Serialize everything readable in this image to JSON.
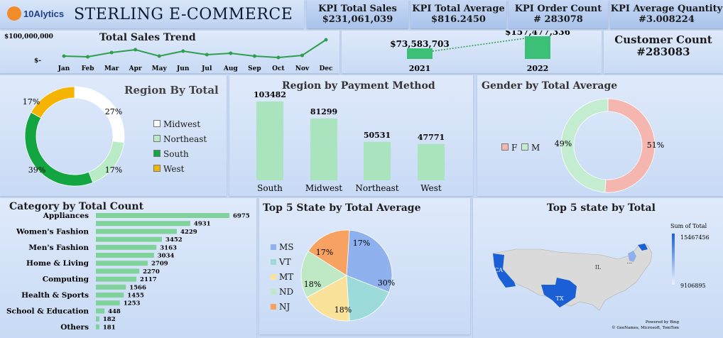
{
  "header": {
    "logo_text": "10Alytics",
    "title": "STERLING E-COMMERCE"
  },
  "kpis": [
    {
      "label": "KPI Total Sales",
      "value": "$231,061,039"
    },
    {
      "label": "KPI Total Average",
      "value": "$816.2450"
    },
    {
      "label": "KPI Order Count",
      "value": "# 283078"
    },
    {
      "label": "KPI Average Quantity",
      "value": "#3.008224"
    }
  ],
  "customer_count": {
    "label": "Customer Count",
    "value": "#283083"
  },
  "chart_data": [
    {
      "id": "sales-trend",
      "type": "line",
      "title": "Total Sales Trend",
      "categories": [
        "Jan",
        "Feb",
        "Mar",
        "Apr",
        "May",
        "Jun",
        "Jul",
        "Aug",
        "Sep",
        "Oct",
        "Nov",
        "Dec"
      ],
      "values": [
        1.0,
        0.5,
        3.5,
        5.5,
        1.0,
        4.5,
        2.0,
        3.0,
        1.0,
        0.0,
        1.5,
        12.5
      ],
      "ytick_labels": [
        "$100,000,000",
        "$-"
      ],
      "color": "#2e9e4f"
    },
    {
      "id": "yearly-sales",
      "type": "bar",
      "categories": [
        "2021",
        "2022"
      ],
      "values": [
        73583703,
        157477336
      ],
      "data_labels": [
        "$73,583,703",
        "$157,477,336"
      ],
      "color": "#3cbf76"
    },
    {
      "id": "region-total",
      "type": "pie",
      "title": "Region By Total",
      "labels": [
        "Midwest",
        "Northeast",
        "South",
        "West"
      ],
      "values": [
        27,
        17,
        39,
        17
      ],
      "data_labels": [
        "27%",
        "17%",
        "39%",
        "17%"
      ],
      "colors": [
        "#ffffff",
        "#b9ecc6",
        "#14a543",
        "#f4b400"
      ],
      "legend_position": "right"
    },
    {
      "id": "region-payment",
      "type": "bar",
      "title": "Region by Payment Method",
      "categories": [
        "South",
        "Midwest",
        "Northeast",
        "West"
      ],
      "values": [
        103482,
        81299,
        50531,
        47771
      ],
      "color": "#a9e4bf"
    },
    {
      "id": "gender-average",
      "type": "pie",
      "title": "Gender by Total Average",
      "labels": [
        "F",
        "M"
      ],
      "values": [
        51,
        49
      ],
      "data_labels": [
        "51%",
        "49%"
      ],
      "colors": [
        "#f6b6b0",
        "#c3ecd0"
      ],
      "legend_position": "left"
    },
    {
      "id": "category-count",
      "type": "bar",
      "orientation": "horizontal",
      "title": "Category by Total Count",
      "categories": [
        "Appliances",
        "",
        "Women's Fashion",
        "",
        "Men's Fashion",
        "",
        "Home & Living",
        "",
        "Computing",
        "",
        "Health & Sports",
        "",
        "School & Education",
        "",
        "Others"
      ],
      "values": [
        6975,
        4931,
        4229,
        3452,
        3163,
        3034,
        2709,
        2270,
        2117,
        1566,
        1455,
        1253,
        448,
        182,
        181
      ],
      "color": "#7fd39a"
    },
    {
      "id": "top5-state-average",
      "type": "pie",
      "title": "Top 5 State by Total Average",
      "labels": [
        "MS",
        "VT",
        "MT",
        "ND",
        "NJ"
      ],
      "values": [
        30,
        18,
        18,
        17,
        17
      ],
      "data_labels": [
        "30%",
        "18%",
        "18%",
        "17%",
        "17%"
      ],
      "colors": [
        "#8fb1ee",
        "#9ddbdb",
        "#fbe29a",
        "#bfe9c4",
        "#f7a261"
      ],
      "legend_position": "left"
    },
    {
      "id": "top5-state-total",
      "type": "heatmap",
      "title": "Top 5 state by Total",
      "legend_title": "Sum of Total",
      "legend_range": [
        "15467456",
        "9106895"
      ],
      "state_labels": [
        "CA",
        "TX",
        "IL",
        "..."
      ],
      "credits": [
        "Powered by Bing",
        "© GeoNames, Microsoft, TomTom"
      ]
    }
  ],
  "colors": {
    "accent": "#2e9e4f",
    "map_high": "#1a5fd6",
    "map_low": "#dfe6f5"
  }
}
